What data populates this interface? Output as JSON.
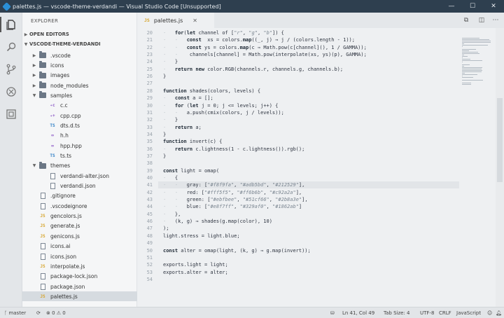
{
  "window": {
    "title": "palettes.js — vscode-theme-verdandi — Visual Studio Code [Unsupported]",
    "controls": {
      "minimize": "—",
      "maximize": "☐",
      "close": "✕"
    }
  },
  "sidebar": {
    "header": "EXPLORER",
    "open_editors": "OPEN EDITORS",
    "project": "VSCODE-THEME-VERDANDI",
    "tree": [
      {
        "label": ".vscode",
        "type": "folder",
        "depth": 1,
        "expanded": false
      },
      {
        "label": "icons",
        "type": "folder",
        "depth": 1,
        "expanded": false
      },
      {
        "label": "images",
        "type": "folder",
        "depth": 1,
        "expanded": false
      },
      {
        "label": "node_modules",
        "type": "folder",
        "depth": 1,
        "expanded": false
      },
      {
        "label": "samples",
        "type": "folder",
        "depth": 1,
        "expanded": true
      },
      {
        "label": "c.c",
        "type": "c",
        "depth": 2,
        "icon_text": "✦c"
      },
      {
        "label": "cpp.cpp",
        "type": "c",
        "depth": 2,
        "icon_text": "✦+"
      },
      {
        "label": "dts.d.ts",
        "type": "ts",
        "depth": 2,
        "icon_text": "TS"
      },
      {
        "label": "h.h",
        "type": "hh",
        "depth": 2,
        "icon_text": "∞"
      },
      {
        "label": "hpp.hpp",
        "type": "hh",
        "depth": 2,
        "icon_text": "∞"
      },
      {
        "label": "ts.ts",
        "type": "ts",
        "depth": 2,
        "icon_text": "TS"
      },
      {
        "label": "themes",
        "type": "folder",
        "depth": 1,
        "expanded": true
      },
      {
        "label": "verdandi-alter.json",
        "type": "file",
        "depth": 2
      },
      {
        "label": "verdandi.json",
        "type": "file",
        "depth": 2
      },
      {
        "label": ".gitignore",
        "type": "file",
        "depth": 1
      },
      {
        "label": ".vscodeignore",
        "type": "file",
        "depth": 1
      },
      {
        "label": "gencolors.js",
        "type": "js",
        "depth": 1,
        "icon_text": "JS"
      },
      {
        "label": "generate.js",
        "type": "js",
        "depth": 1,
        "icon_text": "JS"
      },
      {
        "label": "genicons.js",
        "type": "js",
        "depth": 1,
        "icon_text": "JS"
      },
      {
        "label": "icons.ai",
        "type": "file",
        "depth": 1
      },
      {
        "label": "icons.json",
        "type": "file",
        "depth": 1
      },
      {
        "label": "interpolate.js",
        "type": "js",
        "depth": 1,
        "icon_text": "JS"
      },
      {
        "label": "package-lock.json",
        "type": "file",
        "depth": 1
      },
      {
        "label": "package.json",
        "type": "file",
        "depth": 1
      },
      {
        "label": "palettes.js",
        "type": "js",
        "depth": 1,
        "icon_text": "JS",
        "selected": true
      }
    ]
  },
  "editor": {
    "tab": {
      "icon_text": "JS",
      "label": "palettes.js",
      "close": "✕"
    },
    "current_line": 41,
    "lines": [
      {
        "n": "20",
        "code": [
          [
            "gd",
            "⋅   "
          ],
          [
            "kw",
            "for"
          ],
          [
            "",
            "("
          ],
          [
            "kw",
            "let"
          ],
          [
            "",
            " channel of ["
          ],
          [
            "str",
            "\"r\""
          ],
          [
            "",
            ", "
          ],
          [
            "str",
            "\"g\""
          ],
          [
            "",
            ", "
          ],
          [
            "str",
            "\"b\""
          ],
          [
            "",
            "]) {"
          ]
        ]
      },
      {
        "n": "21",
        "code": [
          [
            "gd",
            "⋅   ⋅   "
          ],
          [
            "kw",
            "const"
          ],
          [
            "",
            "",
            " "
          ],
          [
            "",
            " xs = colors."
          ],
          [
            "kw",
            "map"
          ],
          [
            "",
            "((_, j) ⇒ j / (colors.length - 1));"
          ]
        ]
      },
      {
        "n": "22",
        "code": [
          [
            "gd",
            "⋅   ⋅   "
          ],
          [
            "kw",
            "const"
          ],
          [
            "",
            "",
            " ys = colors."
          ],
          [
            "kw",
            "map"
          ],
          [
            "",
            "(c ⇒ Math.pow(c[channel](), 1 / GAMMA));"
          ]
        ]
      },
      {
        "n": "23",
        "code": [
          [
            "gd",
            "⋅   ⋅   "
          ],
          [
            "",
            " channels[channel] = Math.pow(interpolate(xs, ys)(p), GAMMA);"
          ]
        ]
      },
      {
        "n": "24",
        "code": [
          [
            "gd",
            "⋅   "
          ],
          [
            "",
            "}"
          ]
        ]
      },
      {
        "n": "25",
        "code": [
          [
            "gd",
            "⋅   "
          ],
          [
            "kw",
            "return new"
          ],
          [
            "",
            " color.RGB(channels.r, channels.g, channels.b);"
          ]
        ]
      },
      {
        "n": "26",
        "code": [
          [
            "",
            "}"
          ]
        ]
      },
      {
        "n": "27",
        "code": []
      },
      {
        "n": "28",
        "code": [
          [
            "kw",
            "function"
          ],
          [
            "",
            " shades(colors, levels) {"
          ]
        ]
      },
      {
        "n": "29",
        "code": [
          [
            "gd",
            "⋅   "
          ],
          [
            "kw",
            "const"
          ],
          [
            "",
            " a = [];"
          ]
        ]
      },
      {
        "n": "30",
        "code": [
          [
            "gd",
            "⋅   "
          ],
          [
            "kw",
            "for"
          ],
          [
            "",
            " ("
          ],
          [
            "kw",
            "let"
          ],
          [
            "",
            " j = 0; j <= levels; j++) {"
          ]
        ]
      },
      {
        "n": "31",
        "code": [
          [
            "gd",
            "⋅   ⋅   "
          ],
          [
            "",
            "a.push(cmix(colors, j / levels));"
          ]
        ]
      },
      {
        "n": "32",
        "code": [
          [
            "gd",
            "⋅   "
          ],
          [
            "",
            "}"
          ]
        ]
      },
      {
        "n": "33",
        "code": [
          [
            "gd",
            "⋅   "
          ],
          [
            "kw",
            "return"
          ],
          [
            "",
            " a;"
          ]
        ]
      },
      {
        "n": "34",
        "code": [
          [
            "",
            "}"
          ]
        ]
      },
      {
        "n": "35",
        "code": [
          [
            "kw",
            "function"
          ],
          [
            "",
            " invert(c) {"
          ]
        ]
      },
      {
        "n": "36",
        "code": [
          [
            "gd",
            "⋅   "
          ],
          [
            "kw",
            "return"
          ],
          [
            "",
            " c.lightness(1 - c.lightness()).rgb();"
          ]
        ]
      },
      {
        "n": "37",
        "code": [
          [
            "",
            "}"
          ]
        ]
      },
      {
        "n": "38",
        "code": []
      },
      {
        "n": "39",
        "code": [
          [
            "kw",
            "const"
          ],
          [
            "",
            " light = omap("
          ]
        ]
      },
      {
        "n": "40",
        "code": [
          [
            "gd",
            "⋅   "
          ],
          [
            "",
            "{"
          ]
        ]
      },
      {
        "n": "41",
        "code": [
          [
            "gd",
            "⋅   ⋅   "
          ],
          [
            "",
            "gray: ["
          ],
          [
            "str",
            "\"#f8f9fa\""
          ],
          [
            "",
            ", "
          ],
          [
            "str",
            "\"#adb5bd\""
          ],
          [
            "",
            ", "
          ],
          [
            "str",
            "\"#212529\""
          ],
          [
            "",
            "],"
          ]
        ]
      },
      {
        "n": "42",
        "code": [
          [
            "gd",
            "⋅   ⋅   "
          ],
          [
            "",
            "red: ["
          ],
          [
            "str",
            "\"#fff5f5\""
          ],
          [
            "",
            ", "
          ],
          [
            "str",
            "\"#ff6b6b\""
          ],
          [
            "",
            ", "
          ],
          [
            "str",
            "\"#c92a2a\""
          ],
          [
            "",
            "],"
          ]
        ]
      },
      {
        "n": "43",
        "code": [
          [
            "gd",
            "⋅   ⋅   "
          ],
          [
            "",
            "green: ["
          ],
          [
            "str",
            "\"#ebfbee\""
          ],
          [
            "",
            ", "
          ],
          [
            "str",
            "\"#51cf66\""
          ],
          [
            "",
            ", "
          ],
          [
            "str",
            "\"#2b8a3e\""
          ],
          [
            "",
            "],"
          ]
        ]
      },
      {
        "n": "44",
        "code": [
          [
            "gd",
            "⋅   ⋅   "
          ],
          [
            "",
            "blue: ["
          ],
          [
            "str",
            "\"#e8f7ff\""
          ],
          [
            "",
            ", "
          ],
          [
            "str",
            "\"#329af0\""
          ],
          [
            "",
            ", "
          ],
          [
            "str",
            "\"#1862ab\""
          ],
          [
            "",
            "]"
          ]
        ]
      },
      {
        "n": "45",
        "code": [
          [
            "gd",
            "⋅   "
          ],
          [
            "",
            "},"
          ]
        ]
      },
      {
        "n": "46",
        "code": [
          [
            "gd",
            "⋅   "
          ],
          [
            "",
            "(k, g) ⇒ shades(g.map(color), 10)"
          ]
        ]
      },
      {
        "n": "47",
        "code": [
          [
            "",
            ");"
          ]
        ]
      },
      {
        "n": "48",
        "code": [
          [
            "",
            "light.stress = light.blue;"
          ]
        ]
      },
      {
        "n": "49",
        "code": []
      },
      {
        "n": "50",
        "code": [
          [
            "kw",
            "const"
          ],
          [
            "",
            " alter = omap(light, (k, g) ⇒ g.map(invert));"
          ]
        ]
      },
      {
        "n": "51",
        "code": []
      },
      {
        "n": "52",
        "code": [
          [
            "",
            "exports.light = light;"
          ]
        ]
      },
      {
        "n": "53",
        "code": [
          [
            "",
            "exports.alter = alter;"
          ]
        ]
      },
      {
        "n": "54",
        "code": []
      }
    ]
  },
  "statusbar": {
    "branch": "master",
    "problems": "⊗ 0 ⚠ 0",
    "position": "Ln 41, Col 49",
    "tab_size": "Tab Size: 4",
    "encoding": "UTF-8",
    "eol": "CRLF",
    "language": "JavaScript"
  }
}
